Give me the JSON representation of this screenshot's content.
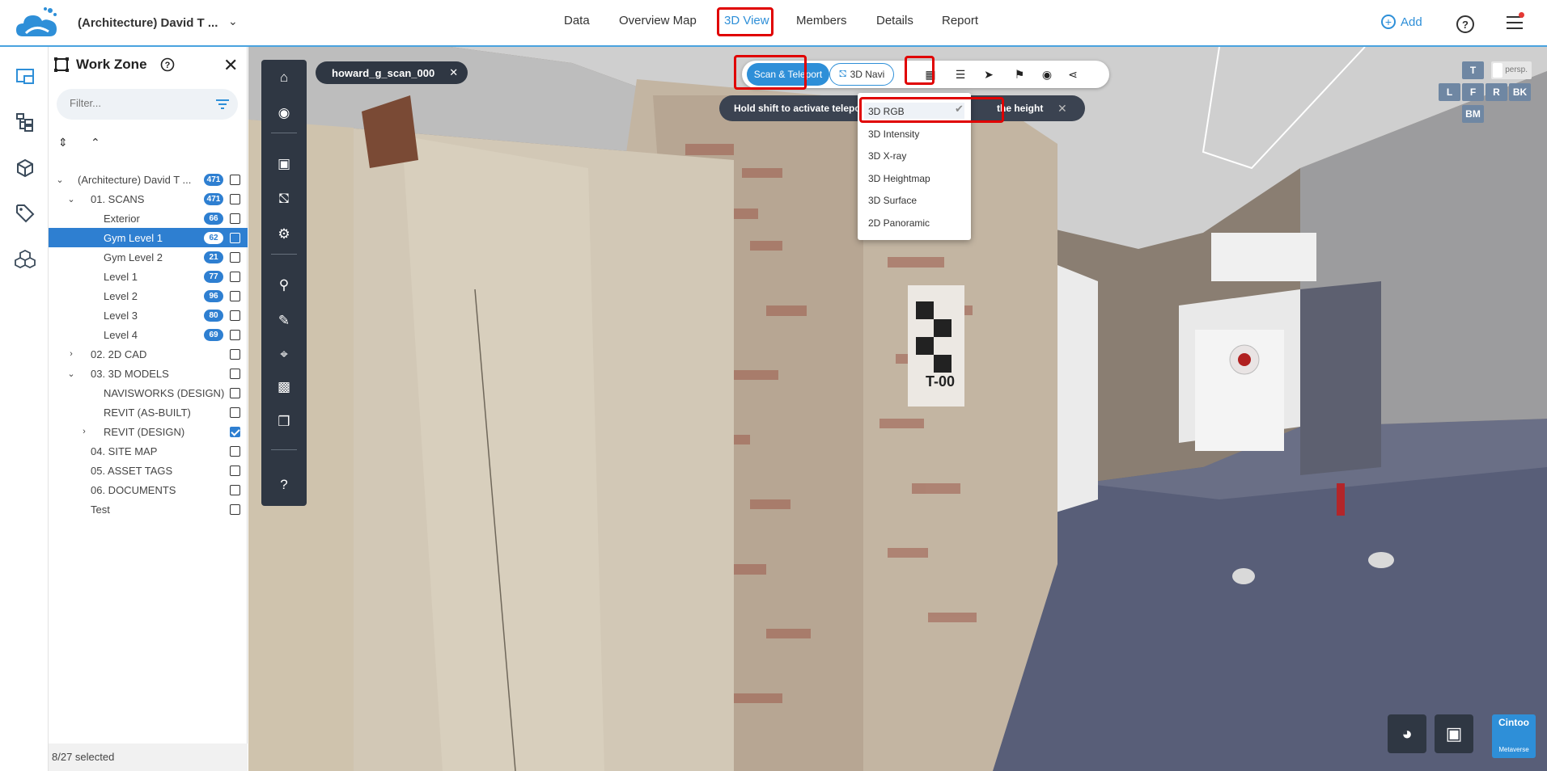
{
  "header": {
    "project_title": "(Architecture) David T ...",
    "nav": [
      "Data",
      "Overview Map",
      "3D View",
      "Members",
      "Details",
      "Report"
    ],
    "active_nav": "3D View",
    "add_label": "Add"
  },
  "work_zone": {
    "title": "Work Zone",
    "filter_placeholder": "Filter...",
    "footer": "8/27 selected",
    "tree": [
      {
        "label": "(Architecture) David T ...",
        "badge": "471"
      },
      {
        "label": "01. SCANS",
        "badge": "471"
      },
      {
        "label": "Exterior",
        "badge": "66"
      },
      {
        "label": "Gym Level 1",
        "badge": "62"
      },
      {
        "label": "Gym Level 2",
        "badge": "21"
      },
      {
        "label": "Level 1",
        "badge": "77"
      },
      {
        "label": "Level 2",
        "badge": "96"
      },
      {
        "label": "Level 3",
        "badge": "80"
      },
      {
        "label": "Level 4",
        "badge": "69"
      },
      {
        "label": "02. 2D CAD"
      },
      {
        "label": "03. 3D MODELS"
      },
      {
        "label": "NAVISWORKS (DESIGN)"
      },
      {
        "label": "REVIT (AS-BUILT)"
      },
      {
        "label": "REVIT (DESIGN)"
      },
      {
        "label": "04. SITE MAP"
      },
      {
        "label": "05. ASSET TAGS"
      },
      {
        "label": "06. DOCUMENTS"
      },
      {
        "label": "Test"
      }
    ]
  },
  "viewer": {
    "scan_name": "howard_g_scan_000",
    "mode_on": "Scan & Teleport",
    "mode_off": "3D Navi",
    "hint_left": "Hold shift to activate telepo",
    "hint_right": "the height",
    "sign_text": "T-00",
    "render_modes": [
      "3D RGB",
      "3D Intensity",
      "3D X-ray",
      "3D Heightmap",
      "3D Surface",
      "2D Panoramic"
    ],
    "selected_render_mode": "3D RGB",
    "view_cube": {
      "top": "T",
      "left": "L",
      "front": "F",
      "right": "R",
      "back": "BK",
      "bottom": "BM",
      "persp": "persp."
    },
    "brand_line1": "Cintoo",
    "brand_line2": "Metaverse"
  }
}
